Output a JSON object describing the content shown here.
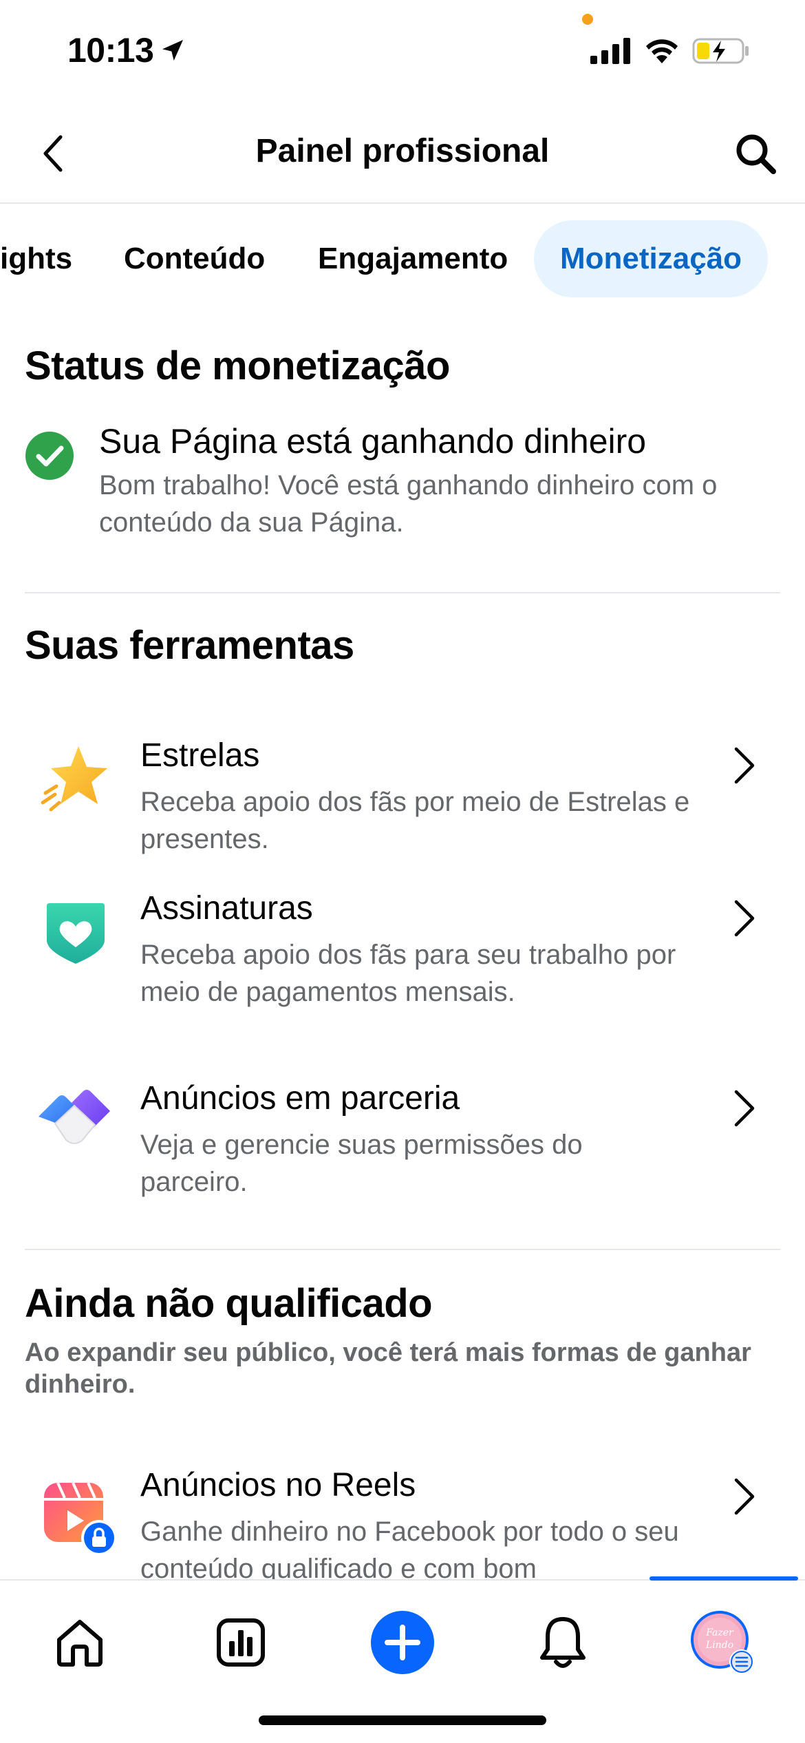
{
  "status_bar": {
    "time": "10:13",
    "location_icon": "location-arrow-icon",
    "signal_icon": "cellular-signal-icon",
    "wifi_icon": "wifi-icon",
    "battery_icon": "battery-charging-icon"
  },
  "header": {
    "title": "Painel profissional",
    "back_icon": "chevron-left-icon",
    "search_icon": "search-icon"
  },
  "tabs": [
    {
      "label": "ights"
    },
    {
      "label": "Conteúdo"
    },
    {
      "label": "Engajamento"
    },
    {
      "label": "Monetização",
      "active": true
    }
  ],
  "monetization_status": {
    "section_title": "Status de monetização",
    "title": "Sua Página está ganhando dinheiro",
    "description": "Bom trabalho! Você está ganhando dinheiro com o conteúdo da sua Página."
  },
  "tools": {
    "section_title": "Suas ferramentas",
    "items": [
      {
        "title": "Estrelas",
        "description": "Receba apoio dos fãs por meio de Estrelas e presentes.",
        "icon": "star-icon"
      },
      {
        "title": "Assinaturas",
        "description": "Receba apoio dos fãs para seu trabalho por meio de pagamentos mensais.",
        "icon": "heart-shield-icon"
      },
      {
        "title": "Anúncios em parceria",
        "description": "Veja e gerencie suas permissões do parceiro.",
        "icon": "partnership-handshake-icon"
      }
    ]
  },
  "not_qualified": {
    "section_title": "Ainda não qualificado",
    "description": "Ao expandir seu público, você terá mais formas de ganhar dinheiro.",
    "items": [
      {
        "title": "Anúncios no Reels",
        "description": "Ganhe dinheiro no Facebook por todo o seu conteúdo qualificado e com bom",
        "icon": "reels-locked-icon"
      }
    ]
  },
  "bottom_nav": {
    "items": [
      "home-icon",
      "insights-chart-icon",
      "create-plus-icon",
      "notifications-bell-icon",
      "profile-avatar-menu-icon"
    ],
    "avatar_text": "Fazer Lindo"
  },
  "colors": {
    "accent": "#0866ff",
    "tab_active_bg": "#e7f3ff",
    "tab_active_text": "#0a66c2",
    "success": "#31a24c",
    "secondary_text": "#65676b"
  }
}
